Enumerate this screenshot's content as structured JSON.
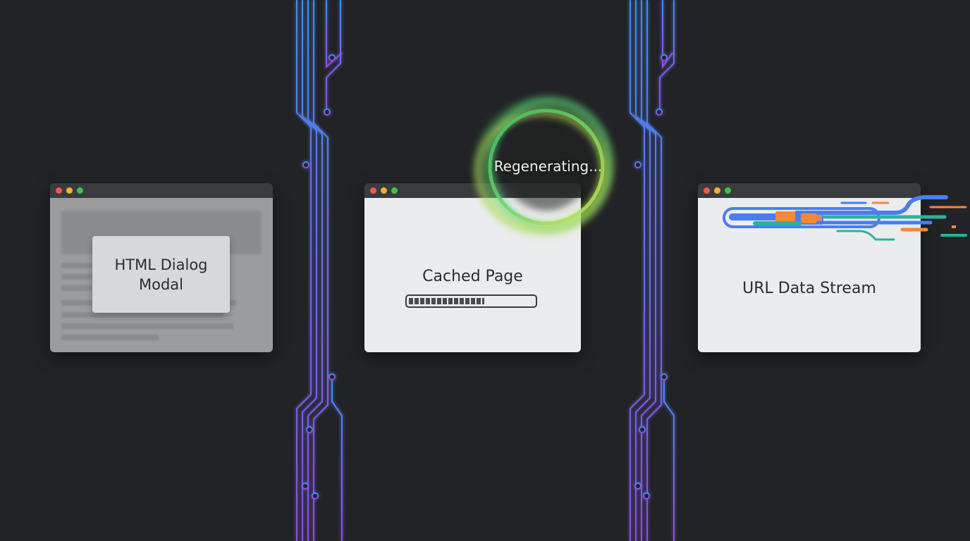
{
  "windows": {
    "dialog": {
      "modal_text": "HTML Dialog\nModal"
    },
    "cache": {
      "label": "Cached Page",
      "progress": 0.62
    },
    "stream": {
      "label": "URL Data Stream"
    }
  },
  "status": {
    "regenerating": "Regenerating..."
  },
  "colors": {
    "background": "#222326",
    "circuit_blue": "#3f8cf0",
    "circuit_purple": "#8b4fe0",
    "window_dot_red": "#ee5a52",
    "window_dot_yellow": "#f2b231",
    "window_dot_green": "#3fc350",
    "ring_green": "#5ad17a",
    "ring_yellow": "#c6e04a",
    "stream_blue": "#4a7df0",
    "stream_orange": "#f5873a",
    "stream_teal": "#2bb39a"
  }
}
